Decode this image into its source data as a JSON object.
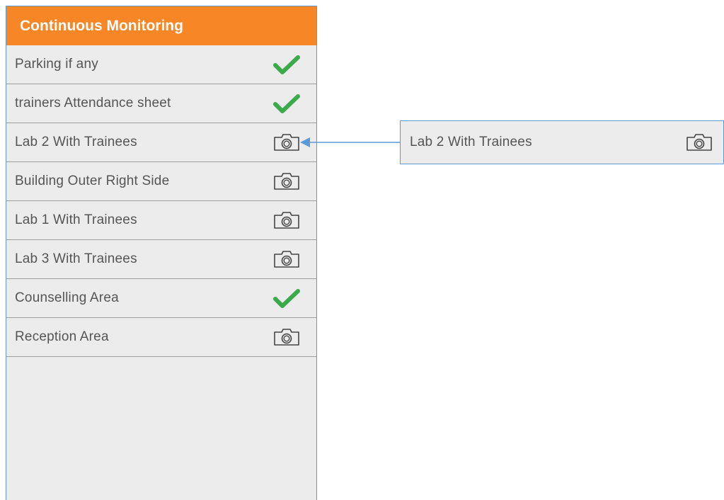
{
  "panel": {
    "title": "Continuous Monitoring",
    "items": [
      {
        "label": "Parking if any",
        "icon": "check-icon"
      },
      {
        "label": "trainers Attendance sheet",
        "icon": "check-icon"
      },
      {
        "label": "Lab 2 With Trainees",
        "icon": "camera-icon"
      },
      {
        "label": "Building Outer Right Side",
        "icon": "camera-icon"
      },
      {
        "label": "Lab 1 With Trainees",
        "icon": "camera-icon"
      },
      {
        "label": "Lab 3 With Trainees",
        "icon": "camera-icon"
      },
      {
        "label": "Counselling Area",
        "icon": "check-icon"
      },
      {
        "label": "Reception Area",
        "icon": "camera-icon"
      }
    ]
  },
  "callout": {
    "label": "Lab 2 With Trainees",
    "icon": "camera-icon"
  },
  "colors": {
    "header": "#f78627",
    "check": "#3aaa4a",
    "border": "#5b9bd5",
    "row_bg": "#ececec"
  }
}
